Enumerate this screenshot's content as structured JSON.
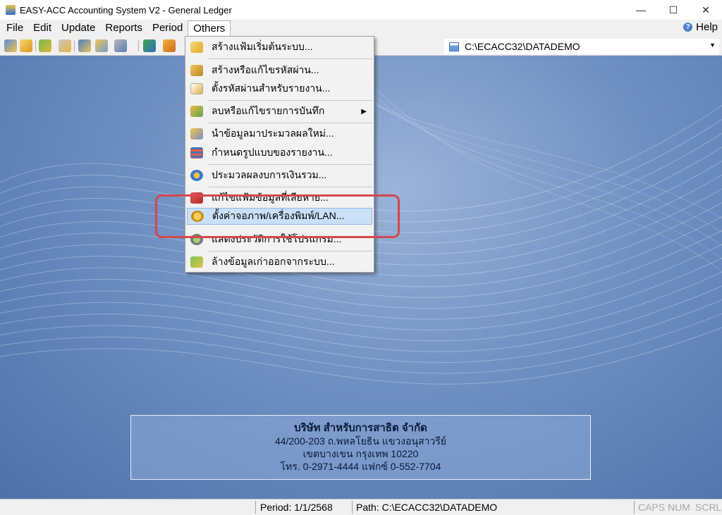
{
  "window": {
    "title": "EASY-ACC Accounting System V2 - General Ledger",
    "minimize": "—",
    "maximize": "☐",
    "close": "✕"
  },
  "menubar": {
    "items": [
      "File",
      "Edit",
      "Update",
      "Reports",
      "Period",
      "Others"
    ],
    "help_label": "Help"
  },
  "toolbar": {
    "path": "C:\\ECACC32\\DATADEMO"
  },
  "others_menu": {
    "items": [
      "สร้างแฟ้มเริ่มต้นระบบ...",
      "สร้างหรือแก้ไขรหัสผ่าน...",
      "ตั้งรหัสผ่านสำหรับรายงาน...",
      "ลบหรือแก้ไขรายการบันทึก",
      "นำข้อมูลมาประมวลผลใหม่...",
      "กำหนดรูปแบบของรายงาน...",
      "ประมวลผลงบการเงินรวม...",
      "แก้ไขแฟ้มข้อมูลที่เสียหาย...",
      "ตั้งค่าจอภาพ/เครื่องพิมพ์/LAN...",
      "แสดงประวัติการใช้โปรแกรม...",
      "ล้างข้อมูลเก่าออกจากระบบ..."
    ],
    "highlighted_index": 8
  },
  "company": {
    "name": "บริษัท สำหรับการสาธิต จำกัด",
    "address1": "44/200-203 ถ.พหลโยธิน แขวงอนุสาวรีย์",
    "address2": "เขตบางเขน กรุงเทพ 10220",
    "phone": "โทร. 0-2971-4444 แฟกซ์ 0-552-7704"
  },
  "statusbar": {
    "period": "Period: 1/1/2568",
    "path": "Path: C:\\ECACC32\\DATADEMO",
    "caps": "CAPS",
    "num": "NUM",
    "scrl": "SCRL"
  },
  "colors": {
    "highlight_ring": "#d4484d",
    "menu_hover": "#c9e0f7",
    "desktop": "#6f90c2"
  }
}
